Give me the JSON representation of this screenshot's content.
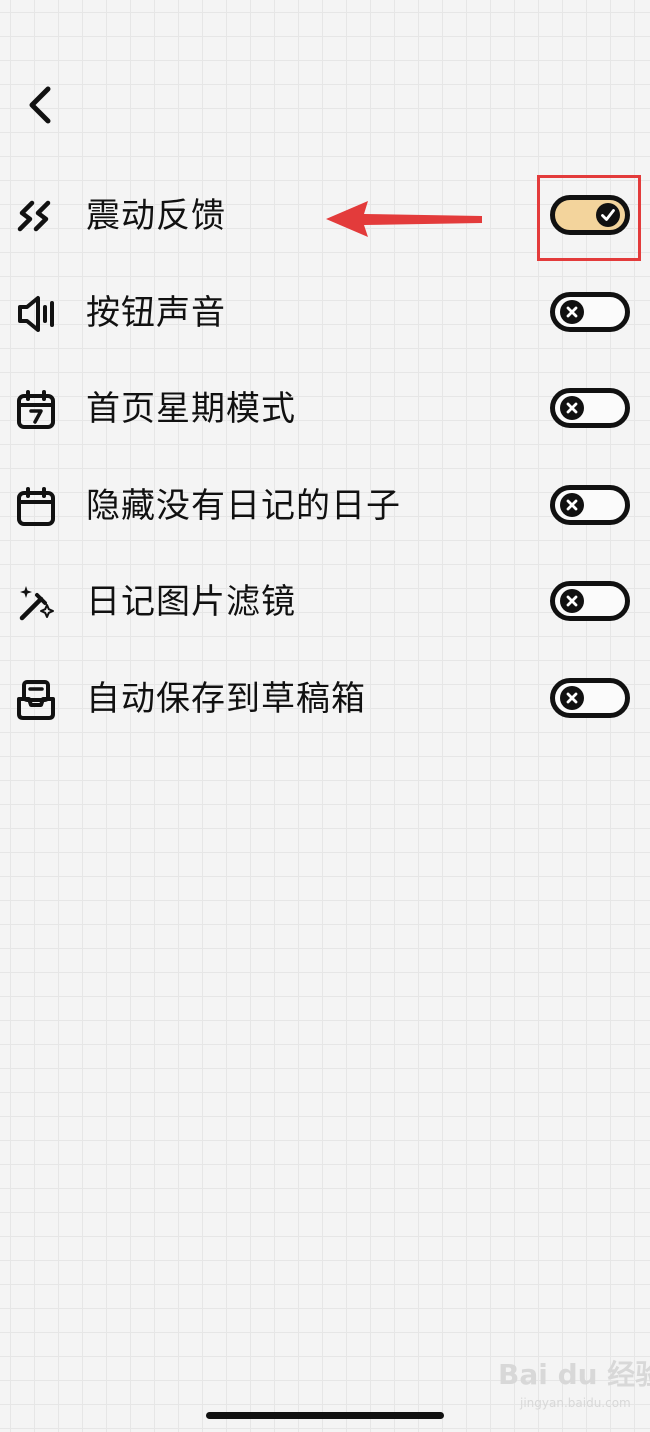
{
  "header": {
    "back_icon": "chevron-left-icon"
  },
  "settings": [
    {
      "icon": "vibration-icon",
      "label": "震动反馈",
      "enabled": true
    },
    {
      "icon": "speaker-icon",
      "label": "按钮声音",
      "enabled": false
    },
    {
      "icon": "calendar-week-icon",
      "label": "首页星期模式",
      "enabled": false
    },
    {
      "icon": "calendar-icon",
      "label": "隐藏没有日记的日子",
      "enabled": false
    },
    {
      "icon": "magic-wand-icon",
      "label": "日记图片滤镜",
      "enabled": false
    },
    {
      "icon": "inbox-drafts-icon",
      "label": "自动保存到草稿箱",
      "enabled": false
    }
  ],
  "colors": {
    "toggle_on": "#f3d49c",
    "toggle_off": "#fbfbfb",
    "annotation": "#e33b3b",
    "text": "#111111"
  },
  "watermark": {
    "name": "Bai du 经验",
    "url": "jingyan.baidu.com"
  }
}
